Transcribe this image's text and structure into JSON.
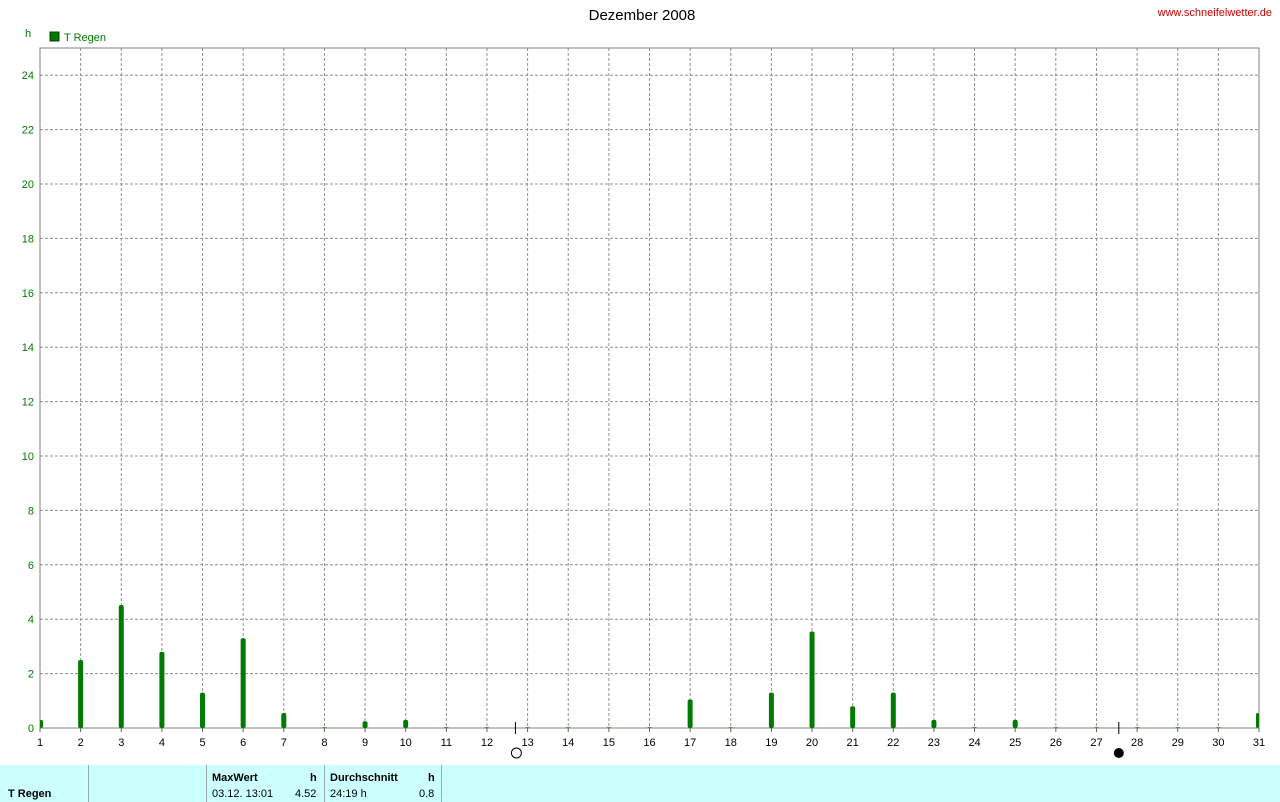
{
  "chart_data": {
    "type": "bar",
    "title": "Dezember 2008",
    "source": "www.schneifelwetter.de",
    "ylabel": "h",
    "ylim": [
      0,
      25
    ],
    "yticks": [
      0,
      2,
      4,
      6,
      8,
      10,
      12,
      14,
      16,
      18,
      20,
      22,
      24
    ],
    "grid": true,
    "legend_position": "top-left",
    "categories": [
      "1",
      "2",
      "3",
      "4",
      "5",
      "6",
      "7",
      "8",
      "9",
      "10",
      "11",
      "12",
      "13",
      "14",
      "15",
      "16",
      "17",
      "18",
      "19",
      "20",
      "21",
      "22",
      "23",
      "24",
      "25",
      "26",
      "27",
      "28",
      "29",
      "30",
      "31"
    ],
    "series": [
      {
        "name": "T Regen",
        "color": "#007a00",
        "values": [
          0.3,
          2.5,
          4.52,
          2.8,
          1.3,
          3.3,
          0.55,
          0,
          0.25,
          0.3,
          0,
          0,
          0,
          0,
          0,
          0,
          1.05,
          0,
          1.3,
          3.55,
          0.8,
          1.3,
          0.3,
          0,
          0.3,
          0,
          0,
          0,
          0,
          0,
          0.55
        ]
      }
    ],
    "moon_phases": [
      {
        "day": 12.7,
        "phase": "full-moon"
      },
      {
        "day": 27.55,
        "phase": "new-moon"
      }
    ]
  },
  "footer": {
    "series_label": "T Regen",
    "max_header": "MaxWert",
    "max_unit": "h",
    "max_date": "03.12.  13:01",
    "max_value": "4.52",
    "avg_header": "Durchschnitt",
    "avg_unit": "h",
    "avg_total": "24:19 h",
    "avg_value": "0.8"
  }
}
